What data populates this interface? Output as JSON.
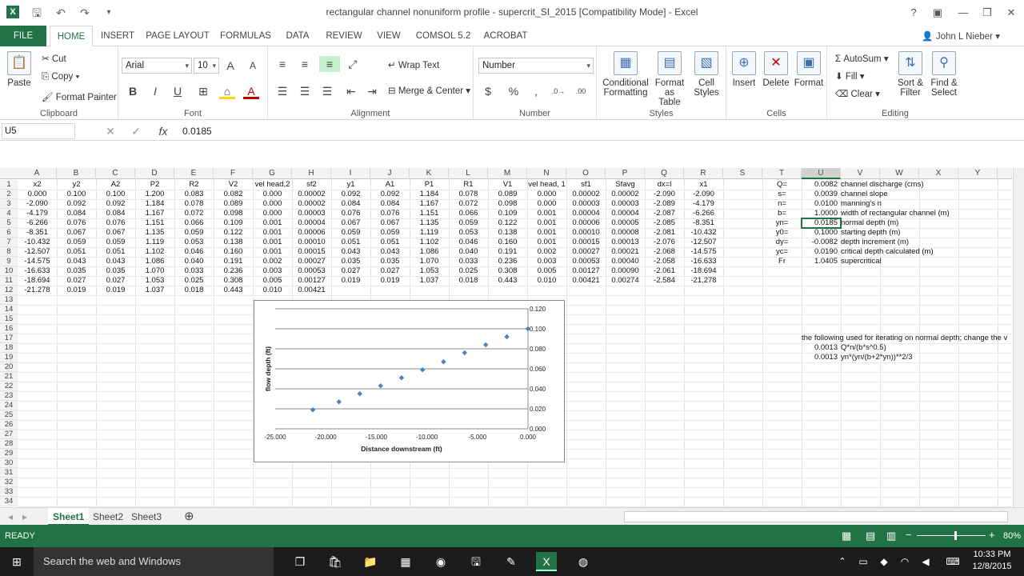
{
  "window": {
    "title": "rectangular channel nonuniform profile - supercrit_SI_2015  [Compatibility Mode] - Excel",
    "user": "John L Nieber",
    "app_icon": "X"
  },
  "tabs": [
    "FILE",
    "HOME",
    "INSERT",
    "PAGE LAYOUT",
    "FORMULAS",
    "DATA",
    "REVIEW",
    "VIEW",
    "COMSOL 5.2",
    "ACROBAT"
  ],
  "ribbon": {
    "clipboard": {
      "name": "Clipboard",
      "paste": "Paste",
      "cut": "Cut",
      "copy": "Copy",
      "format_painter": "Format Painter"
    },
    "font": {
      "name": "Font",
      "family": "Arial",
      "size": "10"
    },
    "alignment": {
      "name": "Alignment",
      "wrap": "Wrap Text",
      "merge": "Merge & Center"
    },
    "number": {
      "name": "Number",
      "format": "Number"
    },
    "styles": {
      "name": "Styles",
      "cond1": "Conditional",
      "cond2": "Formatting",
      "fmt1": "Format as",
      "fmt2": "Table",
      "cell1": "Cell",
      "cell2": "Styles"
    },
    "cells": {
      "name": "Cells",
      "insert": "Insert",
      "delete": "Delete",
      "format": "Format"
    },
    "editing": {
      "name": "Editing",
      "autosum": "AutoSum",
      "fill": "Fill",
      "clear": "Clear",
      "sort1": "Sort &",
      "sort2": "Filter",
      "find1": "Find &",
      "find2": "Select"
    }
  },
  "formula_bar": {
    "name_box": "U5",
    "formula": "0.0185"
  },
  "columns": [
    "A",
    "B",
    "C",
    "D",
    "E",
    "F",
    "G",
    "H",
    "I",
    "J",
    "K",
    "L",
    "M",
    "N",
    "O",
    "P",
    "Q",
    "R",
    "S",
    "T",
    "U",
    "V",
    "W",
    "X",
    "Y"
  ],
  "rows": [
    "1",
    "2",
    "3",
    "4",
    "5",
    "6",
    "7",
    "8",
    "9",
    "10",
    "11",
    "12",
    "13",
    "14",
    "15",
    "16",
    "17",
    "18",
    "19",
    "20",
    "21",
    "22",
    "23",
    "24",
    "25",
    "26",
    "27",
    "28",
    "29",
    "30",
    "31",
    "32",
    "33",
    "34"
  ],
  "table": [
    [
      "x2",
      "y2",
      "A2",
      "P2",
      "R2",
      "V2",
      "vel head,2",
      "sf2",
      "y1",
      "A1",
      "P1",
      "R1",
      "V1",
      "vel head, 1",
      "sf1",
      "Sfavg",
      "dx=l",
      "x1"
    ],
    [
      "0.000",
      "0.100",
      "0.100",
      "1.200",
      "0.083",
      "0.082",
      "0.000",
      "0.00002",
      "0.092",
      "0.092",
      "1.184",
      "0.078",
      "0.089",
      "0.000",
      "0.00002",
      "0.00002",
      "-2.090",
      "-2.090"
    ],
    [
      "-2.090",
      "0.092",
      "0.092",
      "1.184",
      "0.078",
      "0.089",
      "0.000",
      "0.00002",
      "0.084",
      "0.084",
      "1.167",
      "0.072",
      "0.098",
      "0.000",
      "0.00003",
      "0.00003",
      "-2.089",
      "-4.179"
    ],
    [
      "-4.179",
      "0.084",
      "0.084",
      "1.167",
      "0.072",
      "0.098",
      "0.000",
      "0.00003",
      "0.076",
      "0.076",
      "1.151",
      "0.066",
      "0.109",
      "0.001",
      "0.00004",
      "0.00004",
      "-2.087",
      "-6.266"
    ],
    [
      "-6.266",
      "0.076",
      "0.076",
      "1.151",
      "0.066",
      "0.109",
      "0.001",
      "0.00004",
      "0.067",
      "0.067",
      "1.135",
      "0.059",
      "0.122",
      "0.001",
      "0.00006",
      "0.00005",
      "-2.085",
      "-8.351"
    ],
    [
      "-8.351",
      "0.067",
      "0.067",
      "1.135",
      "0.059",
      "0.122",
      "0.001",
      "0.00006",
      "0.059",
      "0.059",
      "1.119",
      "0.053",
      "0.138",
      "0.001",
      "0.00010",
      "0.00008",
      "-2.081",
      "-10.432"
    ],
    [
      "-10.432",
      "0.059",
      "0.059",
      "1.119",
      "0.053",
      "0.138",
      "0.001",
      "0.00010",
      "0.051",
      "0.051",
      "1.102",
      "0.046",
      "0.160",
      "0.001",
      "0.00015",
      "0.00013",
      "-2.076",
      "-12.507"
    ],
    [
      "-12.507",
      "0.051",
      "0.051",
      "1.102",
      "0.046",
      "0.160",
      "0.001",
      "0.00015",
      "0.043",
      "0.043",
      "1.086",
      "0.040",
      "0.191",
      "0.002",
      "0.00027",
      "0.00021",
      "-2.068",
      "-14.575"
    ],
    [
      "-14.575",
      "0.043",
      "0.043",
      "1.086",
      "0.040",
      "0.191",
      "0.002",
      "0.00027",
      "0.035",
      "0.035",
      "1.070",
      "0.033",
      "0.236",
      "0.003",
      "0.00053",
      "0.00040",
      "-2.058",
      "-16.633"
    ],
    [
      "-16.633",
      "0.035",
      "0.035",
      "1.070",
      "0.033",
      "0.236",
      "0.003",
      "0.00053",
      "0.027",
      "0.027",
      "1.053",
      "0.025",
      "0.308",
      "0.005",
      "0.00127",
      "0.00090",
      "-2.061",
      "-18.694"
    ],
    [
      "-18.694",
      "0.027",
      "0.027",
      "1.053",
      "0.025",
      "0.308",
      "0.005",
      "0.00127",
      "0.019",
      "0.019",
      "1.037",
      "0.018",
      "0.443",
      "0.010",
      "0.00421",
      "0.00274",
      "-2.584",
      "-21.278"
    ],
    [
      "-21.278",
      "0.019",
      "0.019",
      "1.037",
      "0.018",
      "0.443",
      "0.010",
      "0.00421"
    ]
  ],
  "params": [
    [
      "Q=",
      "0.0082",
      "channel discharge (cms)"
    ],
    [
      "s=",
      "0.0039",
      "channel slope"
    ],
    [
      "n=",
      "0.0100",
      "manning's n"
    ],
    [
      "b=",
      "1.0000",
      "width of rectangular channel (m)"
    ],
    [
      "yn=",
      "0.0185",
      "normal depth (m)"
    ],
    [
      "y0=",
      "0.1000",
      "starting depth (m)"
    ],
    [
      "dy=",
      "-0.0082",
      "depth increment (m)"
    ],
    [
      "yc=",
      "0.0190",
      "critical depth calculated (m)"
    ],
    [
      "Fr",
      "1.0405",
      "supercritical"
    ]
  ],
  "iteration": {
    "note": "the following used for iterating on normal depth; change the v",
    "r1v": "0.0013",
    "r1f": "Q*n/(b*s^0.5)",
    "r2v": "0.0013",
    "r2f": "yn*(yn/(b+2*yn))**2/3"
  },
  "chart_data": {
    "type": "scatter",
    "xlabel": "Distance downstream (ft)",
    "ylabel": "flow depth (ft)",
    "xlim": [
      -25,
      0
    ],
    "ylim": [
      0,
      0.12
    ],
    "x_ticks": [
      "-25.000",
      "-20.000",
      "-15.000",
      "-10.000",
      "-5.000",
      "0.000"
    ],
    "y_ticks": [
      "0.120",
      "0.100",
      "0.080",
      "0.060",
      "0.040",
      "0.020",
      "0.000"
    ],
    "points": [
      [
        0,
        0.1
      ],
      [
        -2.09,
        0.092
      ],
      [
        -4.179,
        0.084
      ],
      [
        -6.266,
        0.076
      ],
      [
        -8.351,
        0.067
      ],
      [
        -10.432,
        0.059
      ],
      [
        -12.507,
        0.051
      ],
      [
        -14.575,
        0.043
      ],
      [
        -16.633,
        0.035
      ],
      [
        -18.694,
        0.027
      ],
      [
        -21.278,
        0.019
      ]
    ],
    "marker_color": "#4f81bd"
  },
  "sheets": [
    "Sheet1",
    "Sheet2",
    "Sheet3"
  ],
  "status": {
    "ready": "READY",
    "zoom": "80%"
  },
  "taskbar": {
    "search": "Search the web and Windows",
    "time": "10:33 PM",
    "date": "12/8/2015"
  },
  "colors": {
    "excel_green": "#217346"
  }
}
